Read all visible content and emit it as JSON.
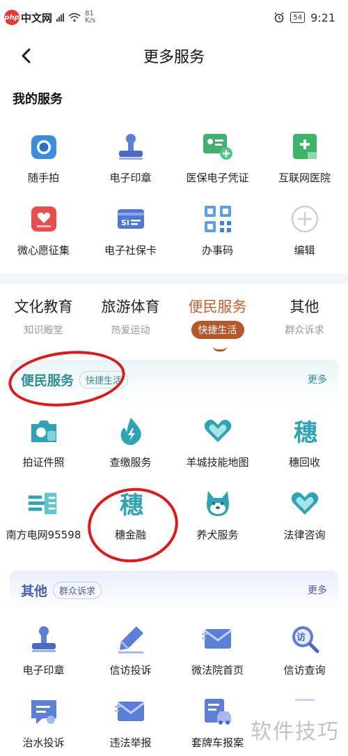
{
  "status_bar": {
    "logo_text": "中文网",
    "logo_badge": "php",
    "net_speed": "81",
    "net_unit": "K/s",
    "battery": "54",
    "time": "9:21"
  },
  "header": {
    "title": "更多服务"
  },
  "my_services": {
    "title": "我的服务",
    "items": [
      {
        "label": "随手拍",
        "icon": "camera-icon"
      },
      {
        "label": "电子印章",
        "icon": "stamp-icon"
      },
      {
        "label": "医保电子凭证",
        "icon": "medical-card-icon"
      },
      {
        "label": "互联网医院",
        "icon": "hospital-icon"
      },
      {
        "label": "微心愿征集",
        "icon": "wish-icon"
      },
      {
        "label": "电子社保卡",
        "icon": "social-card-icon"
      },
      {
        "label": "办事码",
        "icon": "qr-code-icon"
      },
      {
        "label": "编辑",
        "icon": "plus-icon"
      }
    ]
  },
  "tabs": [
    {
      "title": "文化教育",
      "subtitle": "知识殿堂"
    },
    {
      "title": "旅游体育",
      "subtitle": "热爱运动"
    },
    {
      "title": "便民服务",
      "subtitle": "快捷生活"
    },
    {
      "title": "其他",
      "subtitle": "群众诉求"
    }
  ],
  "section_convenience": {
    "title": "便民服务",
    "tag": "快捷生活",
    "more": "更多",
    "items": [
      {
        "label": "拍证件照",
        "icon": "photo-id-icon"
      },
      {
        "label": "查缴服务",
        "icon": "payment-icon"
      },
      {
        "label": "羊城技能地图",
        "icon": "heart-map-icon"
      },
      {
        "label": "穗回收",
        "icon": "sui-icon"
      },
      {
        "label": "南方电网95598",
        "icon": "power-grid-icon"
      },
      {
        "label": "穗金融",
        "icon": "sui-icon"
      },
      {
        "label": "养犬服务",
        "icon": "dog-icon"
      },
      {
        "label": "法律咨询",
        "icon": "heart-map-icon"
      }
    ]
  },
  "section_other": {
    "title": "其他",
    "tag": "群众诉求",
    "more": "更多",
    "items": [
      {
        "label": "电子印章",
        "icon": "stamp-icon"
      },
      {
        "label": "信访投诉",
        "icon": "pen-icon"
      },
      {
        "label": "微法院首页",
        "icon": "mail-icon"
      },
      {
        "label": "信访查询",
        "icon": "search-visit-icon"
      },
      {
        "label": "治水投诉",
        "icon": "chat-icon"
      },
      {
        "label": "违法举报",
        "icon": "mail-icon"
      },
      {
        "label": "套牌车报案",
        "icon": "car-report-icon"
      },
      {
        "label": "",
        "icon": "partial-icon"
      }
    ]
  },
  "watermark": "软件技巧"
}
